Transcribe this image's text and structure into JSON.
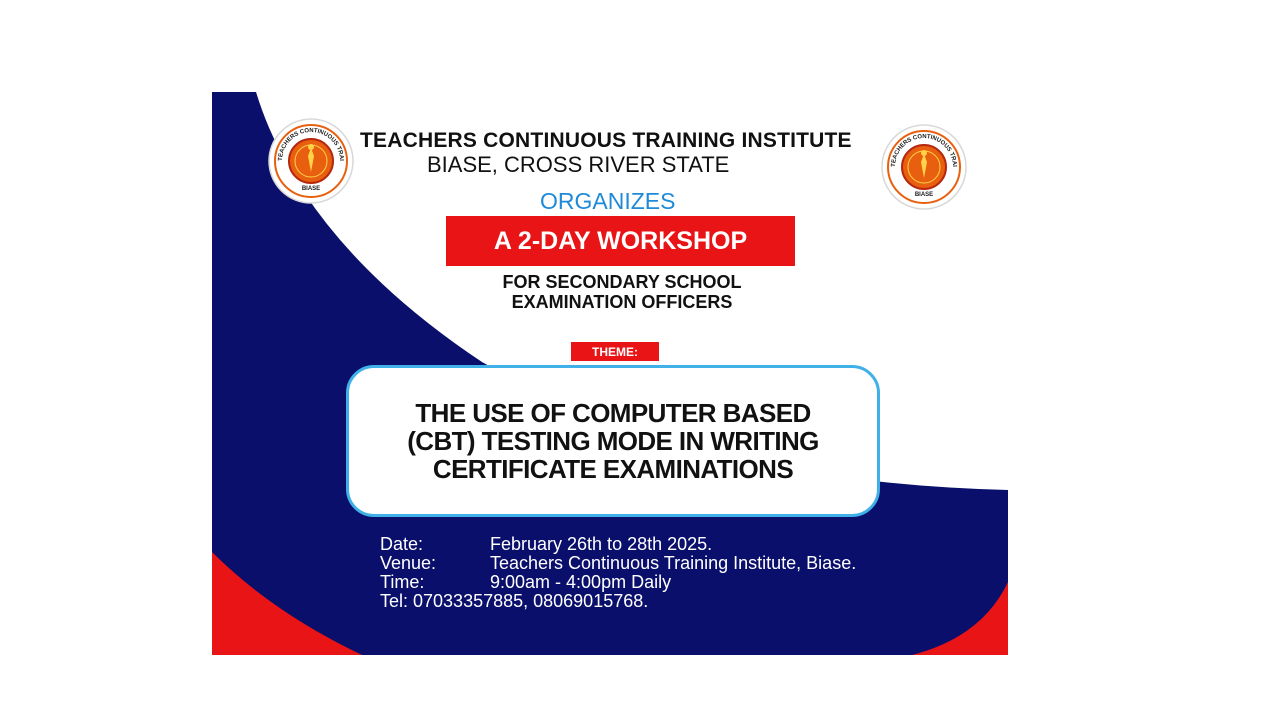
{
  "header": {
    "institution": "TEACHERS CONTINUOUS TRAINING INSTITUTE",
    "location": "BIASE, CROSS RIVER STATE"
  },
  "organizes": "ORGANIZES",
  "workshop": "A 2-DAY WORKSHOP",
  "audience": {
    "line1": "FOR SECONDARY SCHOOL",
    "line2": "EXAMINATION OFFICERS"
  },
  "theme": {
    "tag": "THEME:",
    "line1": "THE USE OF COMPUTER BASED",
    "line2": "(CBT) TESTING MODE IN WRITING",
    "line3": "CERTIFICATE EXAMINATIONS"
  },
  "details": {
    "date_label": "Date:",
    "date_value": "February 26th to 28th 2025.",
    "venue_label": "Venue:",
    "venue_value": "Teachers Continuous Training Institute, Biase.",
    "time_label": "Time:",
    "time_value": "9:00am - 4:00pm Daily",
    "tel": "Tel: 07033357885, 08069015768."
  },
  "logo": {
    "ring_text": "TEACHERS CONTINUOUS TRAINING INSTITUTE",
    "bottom_text": "BIASE"
  },
  "colors": {
    "navy": "#0a0f6b",
    "red": "#e81416",
    "accent_blue": "#1f8ad8",
    "theme_border": "#3fb0e8"
  }
}
